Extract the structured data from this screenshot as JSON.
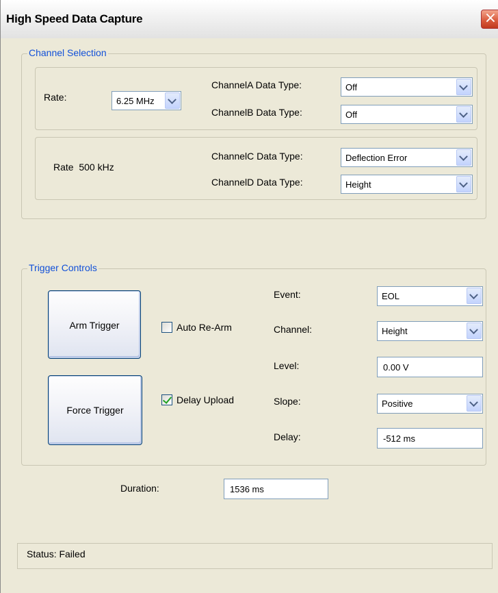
{
  "window": {
    "title": "High Speed Data Capture",
    "close_icon": "×"
  },
  "channel_selection": {
    "label": "Channel Selection",
    "rate_label": "Rate:",
    "rate_value": "6.25 MHz",
    "rate_fixed": "Rate  500 kHz",
    "channel_a_label": "ChannelA Data Type:",
    "channel_a_value": "Off",
    "channel_b_label": "ChannelB Data Type:",
    "channel_b_value": "Off",
    "channel_c_label": "ChannelC Data Type:",
    "channel_c_value": "Deflection Error",
    "channel_d_label": "ChannelD Data Type:",
    "channel_d_value": "Height"
  },
  "trigger_controls": {
    "label": "Trigger Controls",
    "arm_trigger": "Arm Trigger",
    "force_trigger": "Force Trigger",
    "auto_rearm_label": "Auto Re-Arm",
    "auto_rearm_checked": false,
    "delay_upload_label": "Delay Upload",
    "delay_upload_checked": true,
    "event_label": "Event:",
    "event_value": "EOL",
    "channel_label": "Channel:",
    "channel_value": "Height",
    "level_label": "Level:",
    "level_value": "0.00 V",
    "slope_label": "Slope:",
    "slope_value": "Positive",
    "delay_label": "Delay:",
    "delay_value": "-512 ms"
  },
  "duration": {
    "label": "Duration:",
    "value": "1536 ms"
  },
  "status": {
    "text": "Status: Failed"
  }
}
